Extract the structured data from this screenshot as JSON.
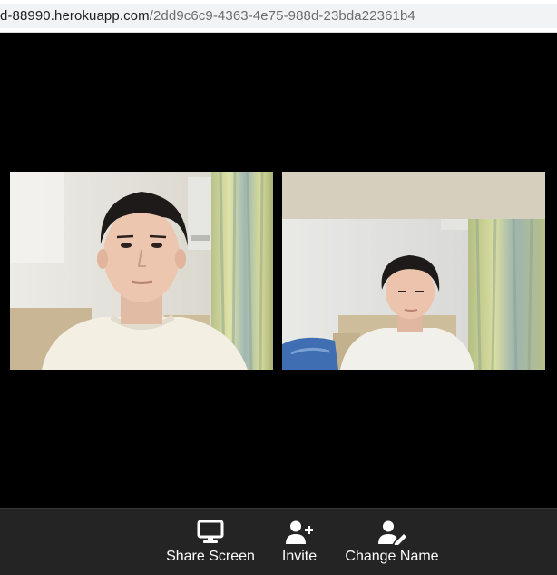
{
  "browser": {
    "url_host": "d-88990.herokuapp.com",
    "url_path": "/2dd9c6c9-4363-4e75-988d-23bda22361b4"
  },
  "participants": [
    {
      "icon": "participant-video-icon"
    },
    {
      "icon": "participant-video-icon"
    }
  ],
  "controls": {
    "share_screen": {
      "label": "Share Screen",
      "icon": "monitor-icon"
    },
    "invite": {
      "label": "Invite",
      "icon": "user-plus-icon"
    },
    "change_name": {
      "label": "Change Name",
      "icon": "user-edit-icon"
    }
  },
  "colors": {
    "background": "#000000",
    "control_bar": "#242424",
    "control_text": "#ffffff"
  }
}
